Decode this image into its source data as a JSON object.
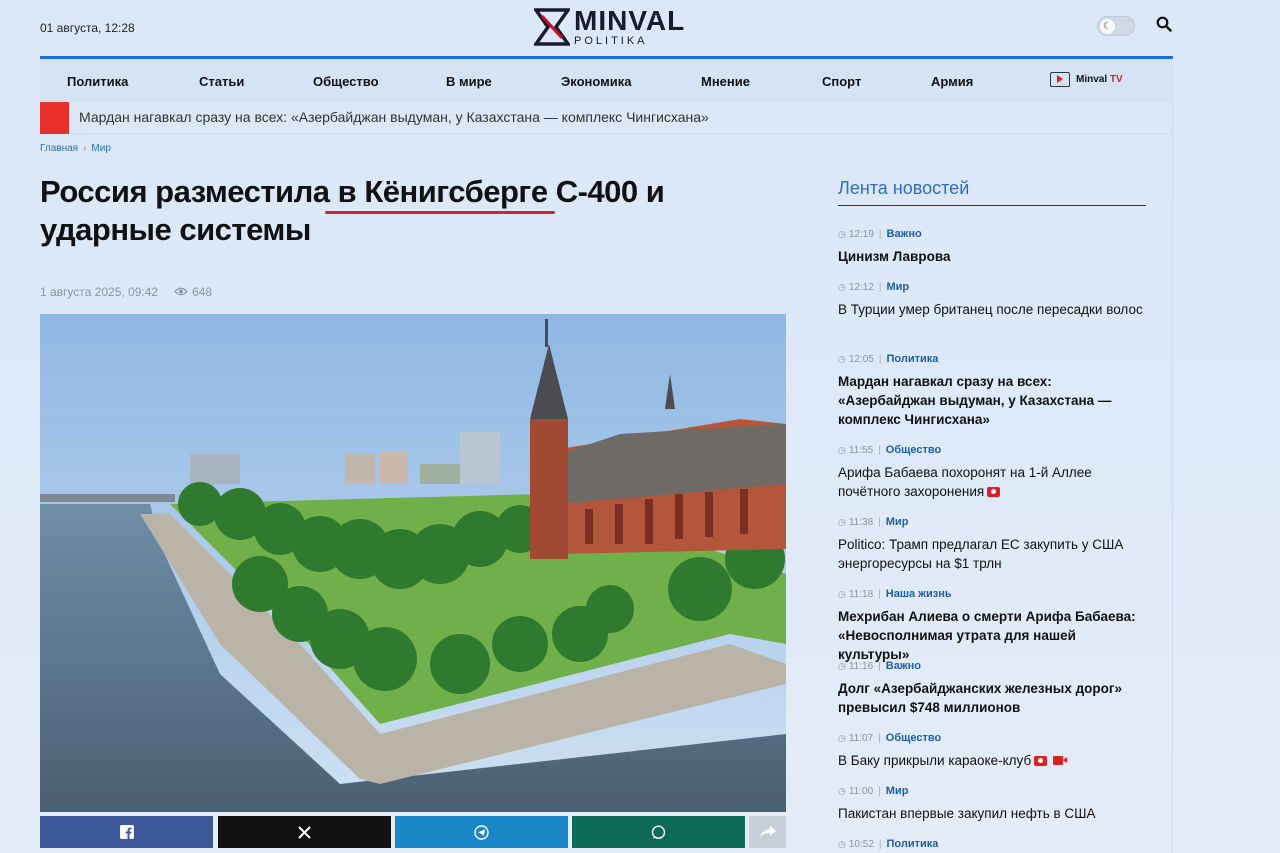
{
  "header": {
    "date": "01 августа, 12:28",
    "logo_main": "MINVAL",
    "logo_sub": "POLITIKA",
    "theme_toggle": "dark-mode",
    "search_icon": "search-icon"
  },
  "nav": {
    "items": [
      "Политика",
      "Статьи",
      "Общество",
      "В мире",
      "Экономика",
      "Мнение",
      "Спорт",
      "Армия"
    ],
    "tv_label": "Minval",
    "tv_suffix": "TV"
  },
  "ticker": {
    "text": "Мардан нагавкал сразу на всех: «Азербайджан выдуман, у Казахстана — комплекс Чингисхана»"
  },
  "breadcrumb": [
    "Главная",
    "Мир"
  ],
  "article": {
    "title": "Россия разместила в Кёнигсберге С-400 и ударные системы",
    "date": "1 августа 2025, 09:42",
    "views": "648"
  },
  "share": {
    "icons": [
      "facebook-icon",
      "x-icon",
      "telegram-icon",
      "whatsapp-icon",
      "share-icon"
    ]
  },
  "feed": {
    "title": "Лента новостей",
    "items": [
      {
        "time": "12:19",
        "cat": "Важно",
        "title": "Цинизм Лаврова",
        "bold": true
      },
      {
        "time": "12:12",
        "cat": "Мир",
        "title": "В Турции умер британец после пересадки волос",
        "bold": false
      },
      {
        "time": "12:05",
        "cat": "Политика",
        "title": "Мардан нагавкал сразу на всех: «Азербайджан выдуман, у Казахстана — комплекс Чингисхана»",
        "bold": true
      },
      {
        "time": "11:55",
        "cat": "Общество",
        "title": "Арифа Бабаева похоронят на 1-й Аллее почётного захоронения",
        "bold": false,
        "photo": true
      },
      {
        "time": "11:38",
        "cat": "Мир",
        "title": "Politico: Трамп предлагал ЕС закупить у США энергоресурсы на $1 трлн",
        "bold": false
      },
      {
        "time": "11:18",
        "cat": "Наша жизнь",
        "title": "Мехрибан Алиева о смерти Арифа Бабаева: «Невосполнимая утрата для нашей культуры»",
        "bold": true
      },
      {
        "time": "11:16",
        "cat": "Важно",
        "title": "Долг «Азербайджанских железных дорог» превысил $748 миллионов",
        "bold": true
      },
      {
        "time": "11:07",
        "cat": "Общество",
        "title": "В Баку прикрыли караоке-клуб",
        "bold": false,
        "photo": true,
        "video": true
      },
      {
        "time": "11:00",
        "cat": "Мир",
        "title": "Пакистан впервые закупил нефть в США",
        "bold": false
      },
      {
        "time": "10:52",
        "cat": "Политика",
        "title": "",
        "bold": false
      }
    ]
  }
}
